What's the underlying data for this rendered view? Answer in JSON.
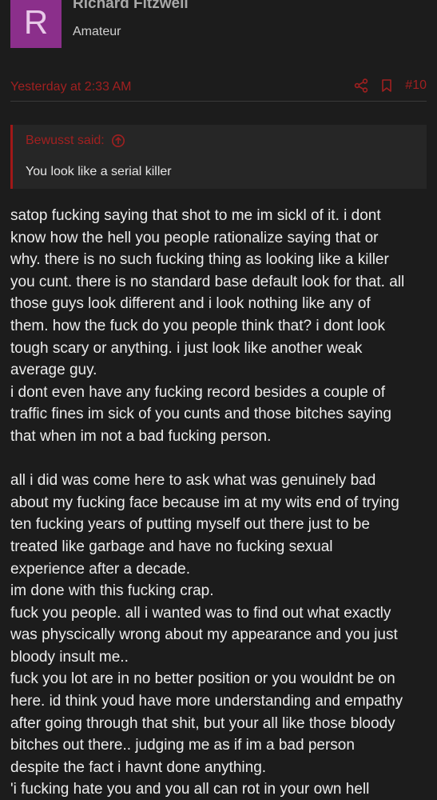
{
  "user": {
    "avatar_letter": "R",
    "name": "Richard Fitzwell",
    "title": "Amateur",
    "avatar_color": "#8b2f8b"
  },
  "post_meta": {
    "timestamp": "Yesterday at 2:33 AM",
    "post_number": "#10",
    "icons": [
      "share-icon",
      "bookmark-icon"
    ],
    "accent_color": "#a02020"
  },
  "quote": {
    "author_label": "Bewusst said:",
    "author_icon": "arrow-up-circle-icon",
    "text": "You look like a serial killer"
  },
  "post": {
    "lines": [
      "satop fucking saying that shot to me im sickl of it. i dont",
      "know how the hell you people rationalize saying that or",
      "why. there is no such fucking thing as looking like a killer",
      "you cunt. there is no standard base default look for that. all",
      "those guys look different and i look nothing like any of",
      "them. how the fuck do you people think that? i dont look",
      "tough scary or anything. i just look like another weak",
      "average guy.",
      "i dont even have any fucking record besides a couple of",
      "traffic fines im sick of you cunts and those bitches saying",
      "that when im not a bad fucking person.",
      "",
      "all i did was come here to ask what was genuinely bad",
      "about my fucking face because im at my wits end of trying",
      "ten fucking years of putting myself out there just to be",
      "treated like garbage and have no fucking sexual",
      "experience after a decade.",
      "im done with this fucking crap.",
      "fuck you people. all i wanted was to find out what exactly",
      "was physcically wrong about my appearance and you just",
      "bloody insult me..",
      "fuck you lot are in no better position or you wouldnt be on",
      "here. id think youd have more understanding and empathy",
      "after going through that shit, but your all like those bloody",
      "bitches out there.. judging me as if im a bad person",
      "despite the fact i havnt done anything.",
      "'i fucking hate you and you all can rot in your own hell"
    ]
  }
}
